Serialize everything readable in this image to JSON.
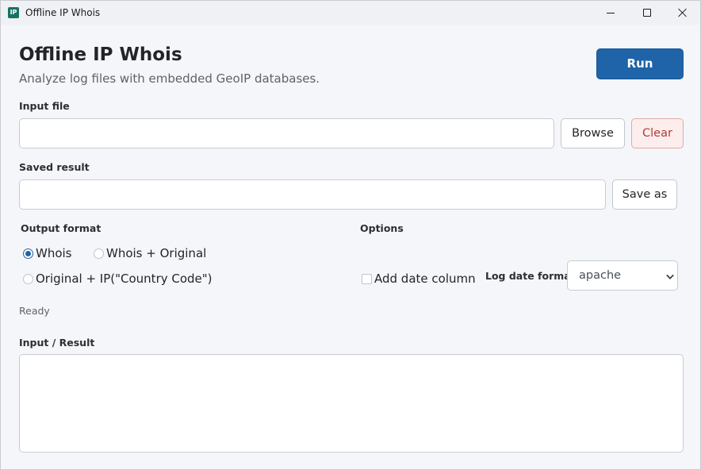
{
  "window": {
    "icon_text": "IP",
    "title": "Offline IP Whois"
  },
  "header": {
    "title": "Offline IP Whois",
    "subtitle": "Analyze log files with embedded GeoIP databases.",
    "run_label": "Run"
  },
  "input_file": {
    "label": "Input file",
    "value": "",
    "browse_label": "Browse",
    "clear_label": "Clear"
  },
  "saved_result": {
    "label": "Saved result",
    "value": "",
    "save_as_label": "Save as"
  },
  "output_format": {
    "label": "Output format",
    "options": [
      {
        "label": "Whois",
        "selected": true
      },
      {
        "label": "Whois + Original",
        "selected": false
      },
      {
        "label": "Original + IP(\"Country Code\")",
        "selected": false
      }
    ]
  },
  "options": {
    "label": "Options",
    "add_date_column_label": "Add date column",
    "add_date_column_checked": false,
    "log_date_format_label": "Log date format",
    "log_date_format_value": "apache"
  },
  "status": "Ready",
  "result": {
    "label": "Input / Result",
    "value": ""
  },
  "colors": {
    "accent": "#1f63a8",
    "clear_text": "#b33b36",
    "app_icon": "#167363",
    "background": "#f5f6f9"
  }
}
